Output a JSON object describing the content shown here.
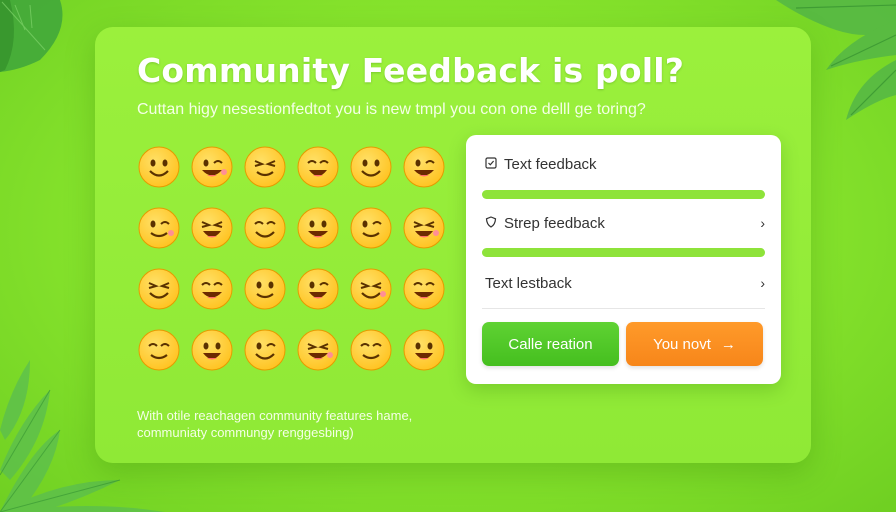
{
  "colors": {
    "background": "#86e32c",
    "card": "#96ee3a",
    "progress_bar": "#8ee33a",
    "primary_button": "#45bf1f",
    "secondary_button": "#f7861a",
    "emoji_face": "#ffc21f"
  },
  "page": {
    "title": "Community Feedback is poll?",
    "subtitle": "Cuttan higy nesestionfedtot you is new tmpl you con one delll ge toring?"
  },
  "emoji_grid": {
    "rows": 4,
    "columns": 6,
    "icon": "smiley-emoji-icon"
  },
  "panel": {
    "options": [
      {
        "icon": "checkbox-icon",
        "label": "Text feedback",
        "chevron": ""
      },
      {
        "icon": "shield-icon",
        "label": "Strep feedback",
        "chevron": "›"
      },
      {
        "icon": "",
        "label": "Text lestback",
        "chevron": "›"
      }
    ],
    "buttons": {
      "primary_label": "Calle reation",
      "secondary_label": "You novt",
      "secondary_icon": "arrow-right-icon",
      "secondary_arrow": "→"
    }
  },
  "footer": {
    "line1": "With otile reachagen community features hame,",
    "line2": "communiaty commungy renggesbing)"
  }
}
